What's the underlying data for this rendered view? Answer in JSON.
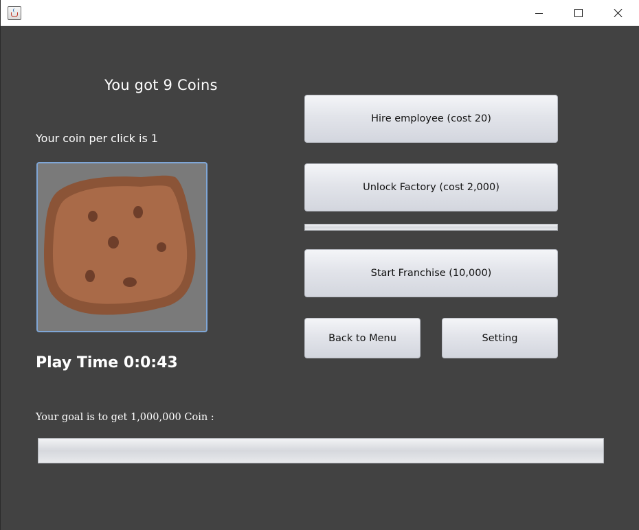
{
  "window": {
    "app_icon": "java-cup-icon",
    "controls": {
      "minimize": "minimize-icon",
      "maximize": "maximize-icon",
      "close": "close-icon"
    }
  },
  "stats": {
    "coins_text": "You got 9 Coins",
    "per_click_text": "Your coin per click is 1",
    "play_time_text": "Play Time 0:0:43"
  },
  "cookie": {
    "icon": "cookie-icon",
    "colors": {
      "background": "#7a7a7a",
      "crust": "#8b5437",
      "dough": "#a96a48",
      "chips": "#6e3e2a"
    }
  },
  "buttons": {
    "hire": "Hire employee (cost 20)",
    "factory": "Unlock Factory (cost 2,000)",
    "franchise": "Start Franchise (10,000)",
    "back": "Back to Menu",
    "setting": "Setting"
  },
  "factory_progress": {
    "fraction": 0
  },
  "goal": {
    "text": "Your goal is to get 1,000,000 Coin :",
    "progress_fraction": 0
  },
  "colors": {
    "window_background": "#424242",
    "text": "#ffffff",
    "cookie_button_border": "#7fa6d6"
  }
}
